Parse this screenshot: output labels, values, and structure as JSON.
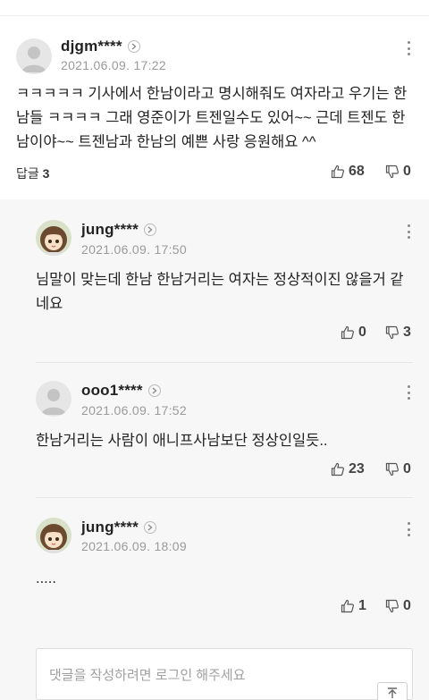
{
  "comments": [
    {
      "author": "djgm****",
      "date": "2021.06.09. 17:22",
      "text": "ㅋㅋㅋㅋㅋ 기사에서 한남이라고 명시해줘도 여자라고 우기는 한남들 ㅋㅋㅋㅋ 그래 영준이가 트젠일수도 있어~~ 근데 트젠도 한남이야~~ 트젠남과 한남의 예쁜 사랑 응원해요 ^^",
      "reply_label": "답글",
      "reply_count": "3",
      "likes": "68",
      "dislikes": "0",
      "avatar": "default-avatar-icon"
    }
  ],
  "replies": [
    {
      "author": "jung****",
      "date": "2021.06.09. 17:50",
      "text": "님말이 맞는데 한남 한남거리는 여자는 정상적이진 않을거 같네요",
      "likes": "0",
      "dislikes": "3",
      "avatar": "anime-girl-avatar"
    },
    {
      "author": "ooo1****",
      "date": "2021.06.09. 17:52",
      "text": "한남거리는 사람이 애니프사남보단 정상인일듯..",
      "likes": "23",
      "dislikes": "0",
      "avatar": "default-avatar-icon"
    },
    {
      "author": "jung****",
      "date": "2021.06.09. 18:09",
      "text": ".....",
      "likes": "1",
      "dislikes": "0",
      "avatar": "anime-girl-avatar"
    }
  ],
  "input": {
    "placeholder": "댓글을 작성하려면 로그인 해주세요"
  },
  "colors": {
    "reply_background": "#f7f7f7",
    "text": "#222222",
    "meta": "#9a9a9a"
  }
}
